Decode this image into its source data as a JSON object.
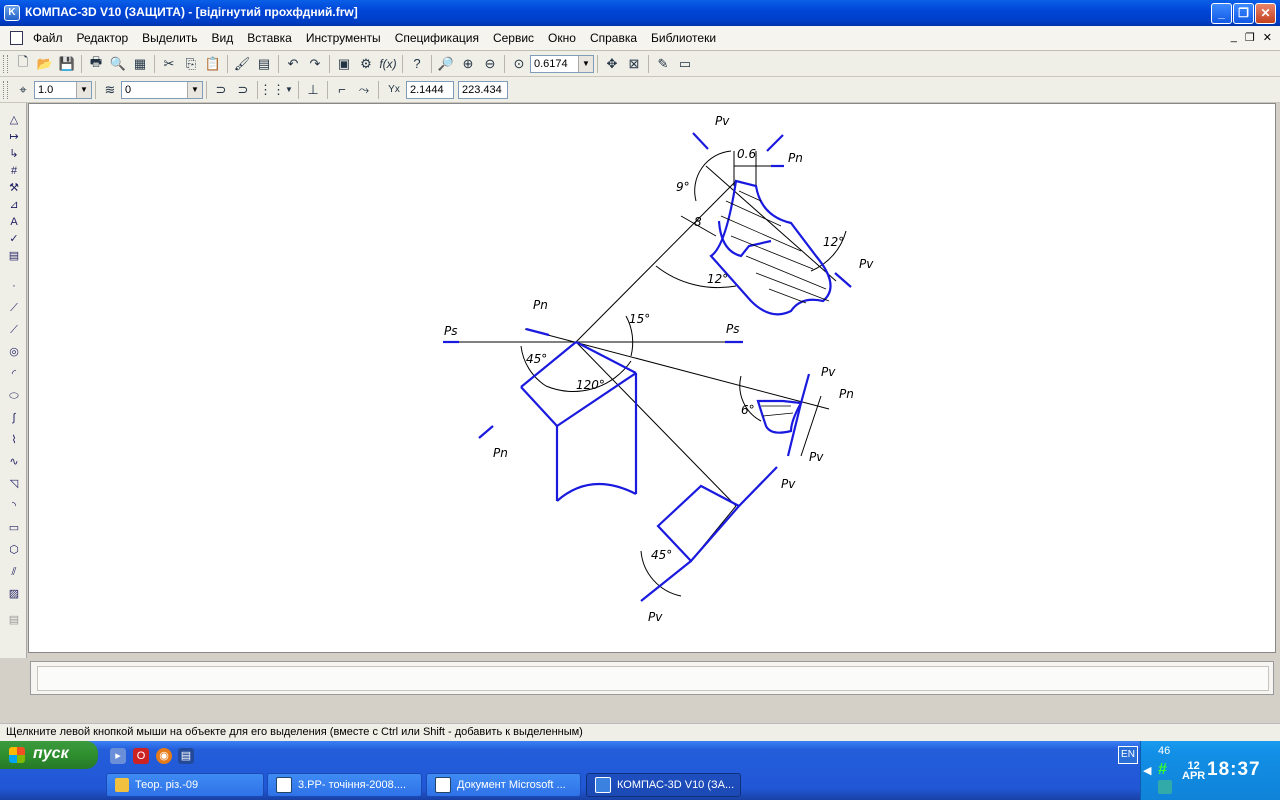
{
  "window": {
    "title": "КОМПАС-3D V10 (ЗАЩИТА) - [відігнутий прохфдний.frw]",
    "app_icon_letter": "K",
    "min_glyph": "_",
    "max_glyph": "❐",
    "close_glyph": "✕"
  },
  "menu": {
    "items": [
      "Файл",
      "Редактор",
      "Выделить",
      "Вид",
      "Вставка",
      "Инструменты",
      "Спецификация",
      "Сервис",
      "Окно",
      "Справка",
      "Библиотеки"
    ],
    "mdi_min": "_",
    "mdi_restore": "❐",
    "mdi_close": "✕"
  },
  "toolbar1": {
    "icons": [
      "new-icon",
      "open-icon",
      "save-icon",
      "print-icon",
      "preview-icon",
      "properties-icon",
      "cut-icon",
      "copy-icon",
      "paste-icon",
      "format-brush-icon",
      "doc-manager-icon",
      "undo-icon",
      "redo-icon",
      "manager-icon",
      "library-icon",
      "formula-icon",
      "help-icon",
      "zoom-window-icon",
      "zoom-in-icon",
      "zoom-out-icon",
      "zoom-scale-icon",
      "pan-icon",
      "fit-all-icon",
      "rebuild-icon",
      "display-icon"
    ],
    "zoom_value": "0.6174"
  },
  "toolbar2": {
    "step_value": "1.0",
    "layer_value": "0",
    "coord_x": "2.1444",
    "coord_y": "223.434",
    "coord_label": "Yx"
  },
  "drawing": {
    "labels": {
      "pv_top": "Pv",
      "pn_top": "Pn",
      "dim_06": "0.6",
      "dim_9": "9°",
      "dim_8": "8",
      "dim_12a": "12°",
      "dim_12b": "12°",
      "pv_right_top": "Pv",
      "pn_mid": "Pn",
      "ps_left": "Ps",
      "ps_right": "Ps",
      "dim_15": "15°",
      "dim_45a": "45°",
      "dim_120": "120°",
      "pv_mid": "Pv",
      "pn_right": "Pn",
      "dim_6": "6°",
      "pn_bottom": "Pn",
      "pv_mid2": "Pv",
      "pv_lower": "Pv",
      "dim_45b": "45°",
      "pv_bottom": "Pv"
    }
  },
  "status": {
    "message": "Щелкните левой кнопкой мыши на объекте для его выделения (вместе с Ctrl или Shift - добавить к выделенным)"
  },
  "taskbar": {
    "start_label": "пуск",
    "tasks": [
      {
        "label": "Теор. різ.-09",
        "active": false
      },
      {
        "label": "3.РР- точіння-2008....",
        "active": false
      },
      {
        "label": "Документ Microsoft ...",
        "active": false
      },
      {
        "label": "КОМПАС-3D V10 (ЗА...",
        "active": true
      }
    ],
    "lang": "EN",
    "tray_number": "46",
    "day": "12",
    "month": "APR",
    "time": "18:37"
  },
  "colors": {
    "drawing_blue": "#1a1adf",
    "titlebar_blue": "#0046d8",
    "taskbar_blue": "#245edb"
  }
}
